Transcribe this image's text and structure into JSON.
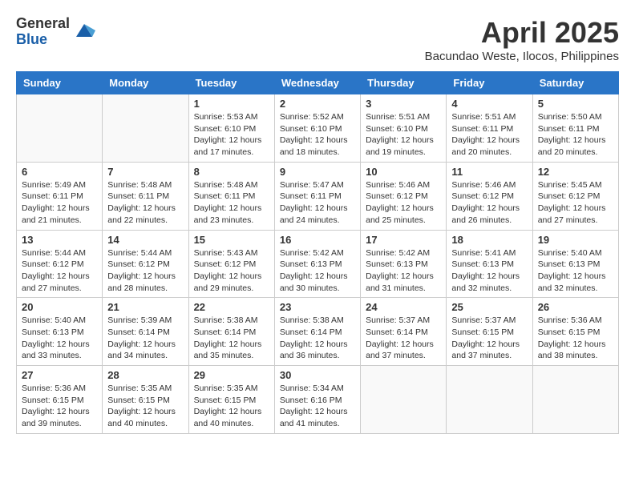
{
  "logo": {
    "general": "General",
    "blue": "Blue"
  },
  "title": "April 2025",
  "subtitle": "Bacundao Weste, Ilocos, Philippines",
  "days_of_week": [
    "Sunday",
    "Monday",
    "Tuesday",
    "Wednesday",
    "Thursday",
    "Friday",
    "Saturday"
  ],
  "weeks": [
    [
      {
        "day": "",
        "info": ""
      },
      {
        "day": "",
        "info": ""
      },
      {
        "day": "1",
        "info": "Sunrise: 5:53 AM\nSunset: 6:10 PM\nDaylight: 12 hours and 17 minutes."
      },
      {
        "day": "2",
        "info": "Sunrise: 5:52 AM\nSunset: 6:10 PM\nDaylight: 12 hours and 18 minutes."
      },
      {
        "day": "3",
        "info": "Sunrise: 5:51 AM\nSunset: 6:10 PM\nDaylight: 12 hours and 19 minutes."
      },
      {
        "day": "4",
        "info": "Sunrise: 5:51 AM\nSunset: 6:11 PM\nDaylight: 12 hours and 20 minutes."
      },
      {
        "day": "5",
        "info": "Sunrise: 5:50 AM\nSunset: 6:11 PM\nDaylight: 12 hours and 20 minutes."
      }
    ],
    [
      {
        "day": "6",
        "info": "Sunrise: 5:49 AM\nSunset: 6:11 PM\nDaylight: 12 hours and 21 minutes."
      },
      {
        "day": "7",
        "info": "Sunrise: 5:48 AM\nSunset: 6:11 PM\nDaylight: 12 hours and 22 minutes."
      },
      {
        "day": "8",
        "info": "Sunrise: 5:48 AM\nSunset: 6:11 PM\nDaylight: 12 hours and 23 minutes."
      },
      {
        "day": "9",
        "info": "Sunrise: 5:47 AM\nSunset: 6:11 PM\nDaylight: 12 hours and 24 minutes."
      },
      {
        "day": "10",
        "info": "Sunrise: 5:46 AM\nSunset: 6:12 PM\nDaylight: 12 hours and 25 minutes."
      },
      {
        "day": "11",
        "info": "Sunrise: 5:46 AM\nSunset: 6:12 PM\nDaylight: 12 hours and 26 minutes."
      },
      {
        "day": "12",
        "info": "Sunrise: 5:45 AM\nSunset: 6:12 PM\nDaylight: 12 hours and 27 minutes."
      }
    ],
    [
      {
        "day": "13",
        "info": "Sunrise: 5:44 AM\nSunset: 6:12 PM\nDaylight: 12 hours and 27 minutes."
      },
      {
        "day": "14",
        "info": "Sunrise: 5:44 AM\nSunset: 6:12 PM\nDaylight: 12 hours and 28 minutes."
      },
      {
        "day": "15",
        "info": "Sunrise: 5:43 AM\nSunset: 6:12 PM\nDaylight: 12 hours and 29 minutes."
      },
      {
        "day": "16",
        "info": "Sunrise: 5:42 AM\nSunset: 6:13 PM\nDaylight: 12 hours and 30 minutes."
      },
      {
        "day": "17",
        "info": "Sunrise: 5:42 AM\nSunset: 6:13 PM\nDaylight: 12 hours and 31 minutes."
      },
      {
        "day": "18",
        "info": "Sunrise: 5:41 AM\nSunset: 6:13 PM\nDaylight: 12 hours and 32 minutes."
      },
      {
        "day": "19",
        "info": "Sunrise: 5:40 AM\nSunset: 6:13 PM\nDaylight: 12 hours and 32 minutes."
      }
    ],
    [
      {
        "day": "20",
        "info": "Sunrise: 5:40 AM\nSunset: 6:13 PM\nDaylight: 12 hours and 33 minutes."
      },
      {
        "day": "21",
        "info": "Sunrise: 5:39 AM\nSunset: 6:14 PM\nDaylight: 12 hours and 34 minutes."
      },
      {
        "day": "22",
        "info": "Sunrise: 5:38 AM\nSunset: 6:14 PM\nDaylight: 12 hours and 35 minutes."
      },
      {
        "day": "23",
        "info": "Sunrise: 5:38 AM\nSunset: 6:14 PM\nDaylight: 12 hours and 36 minutes."
      },
      {
        "day": "24",
        "info": "Sunrise: 5:37 AM\nSunset: 6:14 PM\nDaylight: 12 hours and 37 minutes."
      },
      {
        "day": "25",
        "info": "Sunrise: 5:37 AM\nSunset: 6:15 PM\nDaylight: 12 hours and 37 minutes."
      },
      {
        "day": "26",
        "info": "Sunrise: 5:36 AM\nSunset: 6:15 PM\nDaylight: 12 hours and 38 minutes."
      }
    ],
    [
      {
        "day": "27",
        "info": "Sunrise: 5:36 AM\nSunset: 6:15 PM\nDaylight: 12 hours and 39 minutes."
      },
      {
        "day": "28",
        "info": "Sunrise: 5:35 AM\nSunset: 6:15 PM\nDaylight: 12 hours and 40 minutes."
      },
      {
        "day": "29",
        "info": "Sunrise: 5:35 AM\nSunset: 6:15 PM\nDaylight: 12 hours and 40 minutes."
      },
      {
        "day": "30",
        "info": "Sunrise: 5:34 AM\nSunset: 6:16 PM\nDaylight: 12 hours and 41 minutes."
      },
      {
        "day": "",
        "info": ""
      },
      {
        "day": "",
        "info": ""
      },
      {
        "day": "",
        "info": ""
      }
    ]
  ]
}
